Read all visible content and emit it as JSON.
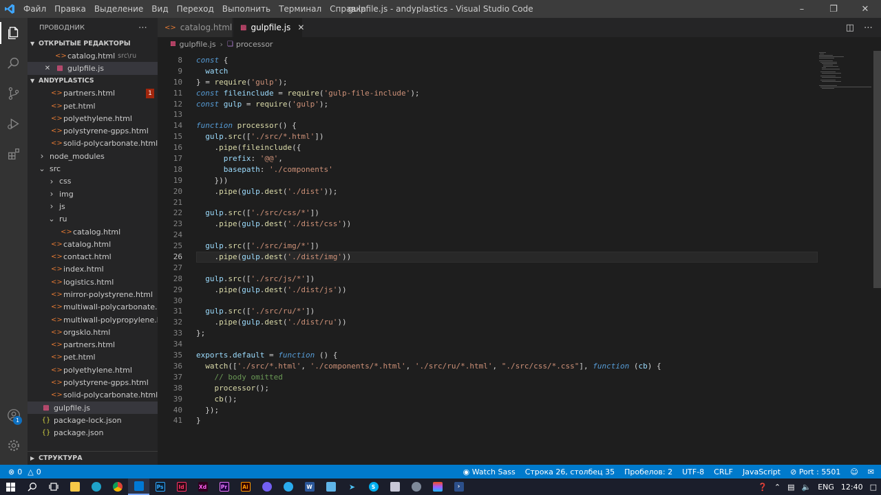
{
  "titlebar": {
    "menu": [
      "Файл",
      "Правка",
      "Выделение",
      "Вид",
      "Переход",
      "Выполнить",
      "Терминал",
      "Справка"
    ],
    "title": "gulpfile.js - andyplastics - Visual Studio Code"
  },
  "sidebar": {
    "header": "ПРОВОДНИК",
    "open_editors_title": "ОТКРЫТЫЕ РЕДАКТОРЫ",
    "open_editors": [
      {
        "name": "catalog.html",
        "path": "src\\ru"
      },
      {
        "name": "gulpfile.js"
      }
    ],
    "project_title": "ANDYPLASTICS",
    "error_count": "1",
    "tree": [
      {
        "name": "partners.html",
        "type": "html",
        "indent": 1
      },
      {
        "name": "pet.html",
        "type": "html",
        "indent": 1
      },
      {
        "name": "polyethylene.html",
        "type": "html",
        "indent": 1
      },
      {
        "name": "polystyrene-gpps.html",
        "type": "html",
        "indent": 1
      },
      {
        "name": "solid-polycarbonate.html",
        "type": "html",
        "indent": 1
      },
      {
        "name": "node_modules",
        "type": "folder-closed",
        "indent": 0
      },
      {
        "name": "src",
        "type": "folder-open",
        "indent": 0
      },
      {
        "name": "css",
        "type": "folder-closed",
        "indent": 1
      },
      {
        "name": "img",
        "type": "folder-closed",
        "indent": 1
      },
      {
        "name": "js",
        "type": "folder-closed",
        "indent": 1
      },
      {
        "name": "ru",
        "type": "folder-open",
        "indent": 1
      },
      {
        "name": "catalog.html",
        "type": "html",
        "indent": 2
      },
      {
        "name": "catalog.html",
        "type": "html",
        "indent": 1
      },
      {
        "name": "contact.html",
        "type": "html",
        "indent": 1
      },
      {
        "name": "index.html",
        "type": "html",
        "indent": 1
      },
      {
        "name": "logistics.html",
        "type": "html",
        "indent": 1
      },
      {
        "name": "mirror-polystyrene.html",
        "type": "html",
        "indent": 1
      },
      {
        "name": "multiwall-polycarbonate.html",
        "type": "html",
        "indent": 1
      },
      {
        "name": "multiwall-polypropylene.html",
        "type": "html",
        "indent": 1
      },
      {
        "name": "orgsklo.html",
        "type": "html",
        "indent": 1
      },
      {
        "name": "partners.html",
        "type": "html",
        "indent": 1
      },
      {
        "name": "pet.html",
        "type": "html",
        "indent": 1
      },
      {
        "name": "polyethylene.html",
        "type": "html",
        "indent": 1
      },
      {
        "name": "polystyrene-gpps.html",
        "type": "html",
        "indent": 1
      },
      {
        "name": "solid-polycarbonate.html",
        "type": "html",
        "indent": 1
      },
      {
        "name": "gulpfile.js",
        "type": "js",
        "indent": 0,
        "selected": true
      },
      {
        "name": "package-lock.json",
        "type": "json",
        "indent": 0
      },
      {
        "name": "package.json",
        "type": "json",
        "indent": 0
      }
    ],
    "outline_title": "СТРУКТУРА"
  },
  "tabs": [
    {
      "label": "catalog.html",
      "active": false
    },
    {
      "label": "gulpfile.js",
      "active": true
    }
  ],
  "breadcrumb": {
    "file": "gulpfile.js",
    "symbol": "processor"
  },
  "editor": {
    "first_line": 8,
    "current_line": 26,
    "lines": [
      "<span class=\"kw\">const</span> {",
      "  <span class=\"var\">watch</span>",
      "} = <span class=\"fn\">require</span>(<span class=\"str\">'gulp'</span>);",
      "<span class=\"kw\">const</span> <span class=\"var\">fileinclude</span> = <span class=\"fn\">require</span>(<span class=\"str\">'gulp-file-include'</span>);",
      "<span class=\"kw\">const</span> <span class=\"var\">gulp</span> = <span class=\"fn\">require</span>(<span class=\"str\">'gulp'</span>);",
      "",
      "<span class=\"kw\">function</span> <span class=\"fn\">processor</span>() {",
      "  <span class=\"var\">gulp</span>.<span class=\"fn\">src</span>([<span class=\"str\">'./src/*.html'</span>])",
      "    .<span class=\"fn\">pipe</span>(<span class=\"fn\">fileinclude</span>({",
      "      <span class=\"var\">prefix</span>: <span class=\"str\">'@@'</span>,",
      "      <span class=\"var\">basepath</span>: <span class=\"str\">'./components'</span>",
      "    }))",
      "    .<span class=\"fn\">pipe</span>(<span class=\"var\">gulp</span>.<span class=\"fn\">dest</span>(<span class=\"str\">'./dist'</span>));",
      "",
      "  <span class=\"var\">gulp</span>.<span class=\"fn\">src</span>([<span class=\"str\">'./src/css/*'</span>])",
      "    .<span class=\"fn\">pipe</span>(<span class=\"var\">gulp</span>.<span class=\"fn\">dest</span>(<span class=\"str\">'./dist/css'</span>))",
      "",
      "  <span class=\"var\">gulp</span>.<span class=\"fn\">src</span>([<span class=\"str\">'./src/img/*'</span>])",
      "    .<span class=\"fn\">pipe</span>(<span class=\"var\">gulp</span>.<span class=\"fn\">dest</span>(<span class=\"str\">'./dist/img'</span>))",
      "",
      "  <span class=\"var\">gulp</span>.<span class=\"fn\">src</span>([<span class=\"str\">'./src/js/*'</span>])",
      "    .<span class=\"fn\">pipe</span>(<span class=\"var\">gulp</span>.<span class=\"fn\">dest</span>(<span class=\"str\">'./dist/js'</span>))",
      "",
      "  <span class=\"var\">gulp</span>.<span class=\"fn\">src</span>([<span class=\"str\">'./src/ru/*'</span>])",
      "    .<span class=\"fn\">pipe</span>(<span class=\"var\">gulp</span>.<span class=\"fn\">dest</span>(<span class=\"str\">'./dist/ru'</span>))",
      "};",
      "",
      "<span class=\"var\">exports</span>.<span class=\"var\">default</span> = <span class=\"kw\">function</span> () {",
      "  <span class=\"fn\">watch</span>([<span class=\"str\">'./src/*.html'</span>, <span class=\"str\">'./components/*.html'</span>, <span class=\"str\">'./src/ru/*.html'</span>, <span class=\"str\">\"./src/css/*.css\"</span>], <span class=\"kw\">function</span> (<span class=\"var\">cb</span>) {",
      "    <span class=\"cm\">// body omitted</span>",
      "    <span class=\"fn\">processor</span>();",
      "    <span class=\"fn\">cb</span>();",
      "  });",
      "}"
    ]
  },
  "status": {
    "problems": "0",
    "warnings": "0",
    "watch": "Watch Sass",
    "position": "Строка 26, столбец 35",
    "spaces": "Пробелов: 2",
    "encoding": "UTF-8",
    "eol": "CRLF",
    "language": "JavaScript",
    "port": "Port : 5501"
  },
  "taskbar": {
    "lang": "ENG",
    "time": "12:40"
  },
  "colors": {
    "accent": "#007acc",
    "html_icon": "#e37933",
    "js_icon": "#f55385",
    "json_icon": "#cbcb41"
  }
}
